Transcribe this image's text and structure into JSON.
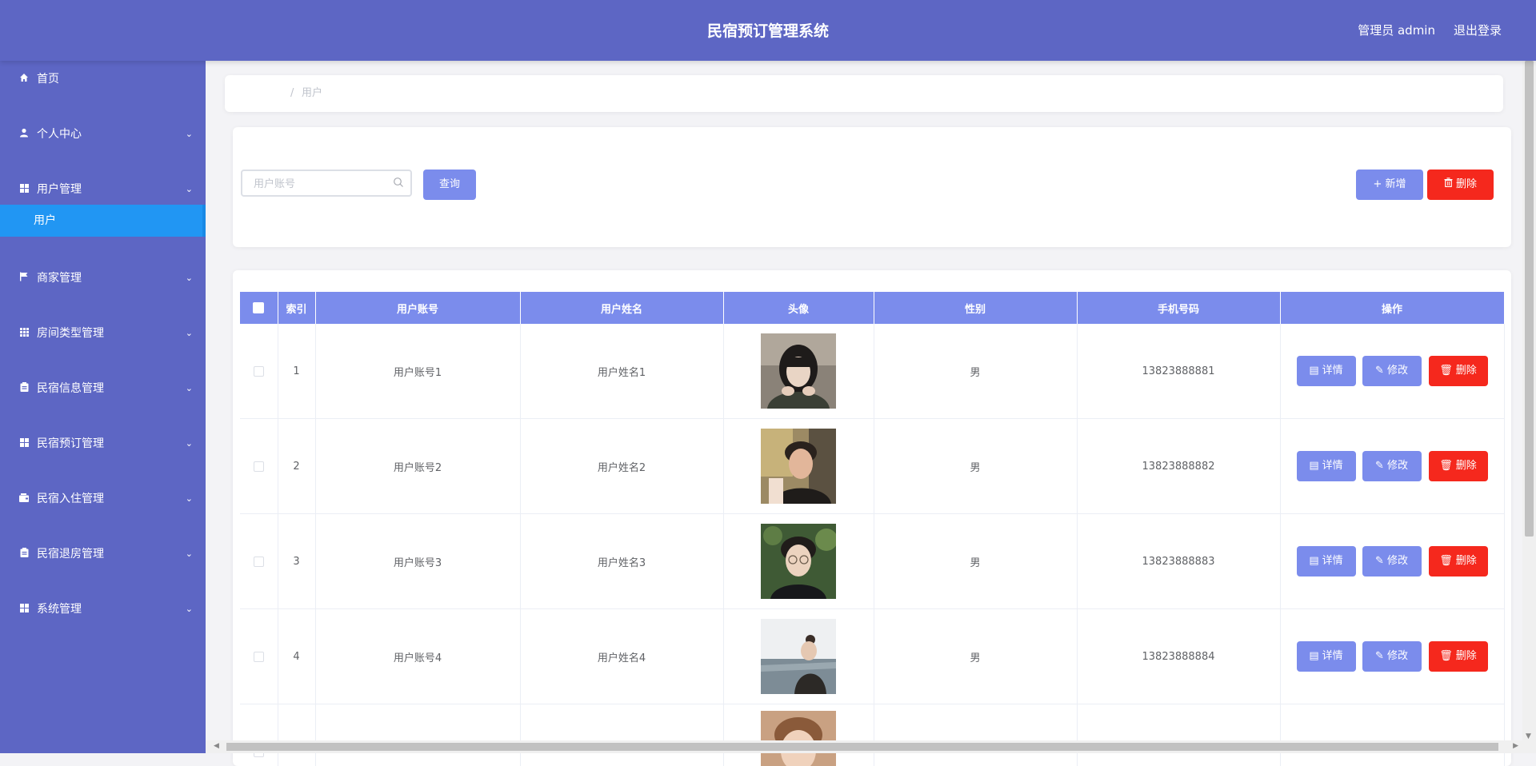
{
  "header": {
    "title": "民宿预订管理系统",
    "user": "管理员 admin",
    "logout": "退出登录"
  },
  "sidebar": {
    "items": [
      {
        "label": "首页",
        "icon": "home-icon"
      },
      {
        "label": "个人中心",
        "icon": "user-icon"
      },
      {
        "label": "用户管理",
        "icon": "grid-icon"
      },
      {
        "label": "商家管理",
        "icon": "flag-icon"
      },
      {
        "label": "房间类型管理",
        "icon": "grid-icon"
      },
      {
        "label": "民宿信息管理",
        "icon": "clipboard-icon"
      },
      {
        "label": "民宿预订管理",
        "icon": "grid-icon"
      },
      {
        "label": "民宿入住管理",
        "icon": "wallet-icon"
      },
      {
        "label": "民宿退房管理",
        "icon": "clipboard-icon"
      },
      {
        "label": "系统管理",
        "icon": "grid-icon"
      }
    ],
    "sub_item": "用户"
  },
  "breadcrumb": {
    "separator": "/",
    "current": "用户"
  },
  "search": {
    "placeholder": "用户账号",
    "query_label": "查询",
    "add_label": "新增",
    "delete_label": "删除"
  },
  "table": {
    "columns": [
      "索引",
      "用户账号",
      "用户姓名",
      "头像",
      "性别",
      "手机号码",
      "操作"
    ],
    "rows": [
      {
        "index": "1",
        "account": "用户账号1",
        "name": "用户姓名1",
        "gender": "男",
        "phone": "13823888881"
      },
      {
        "index": "2",
        "account": "用户账号2",
        "name": "用户姓名2",
        "gender": "男",
        "phone": "13823888882"
      },
      {
        "index": "3",
        "account": "用户账号3",
        "name": "用户姓名3",
        "gender": "男",
        "phone": "13823888883"
      },
      {
        "index": "4",
        "account": "用户账号4",
        "name": "用户姓名4",
        "gender": "男",
        "phone": "13823888884"
      }
    ],
    "actions": {
      "detail": "详情",
      "edit": "修改",
      "delete": "删除"
    }
  },
  "colors": {
    "header_bg": "#5d66c4",
    "sidebar_active": "#2196f3",
    "primary_button": "#7b8cec",
    "danger_button": "#f5281d"
  }
}
